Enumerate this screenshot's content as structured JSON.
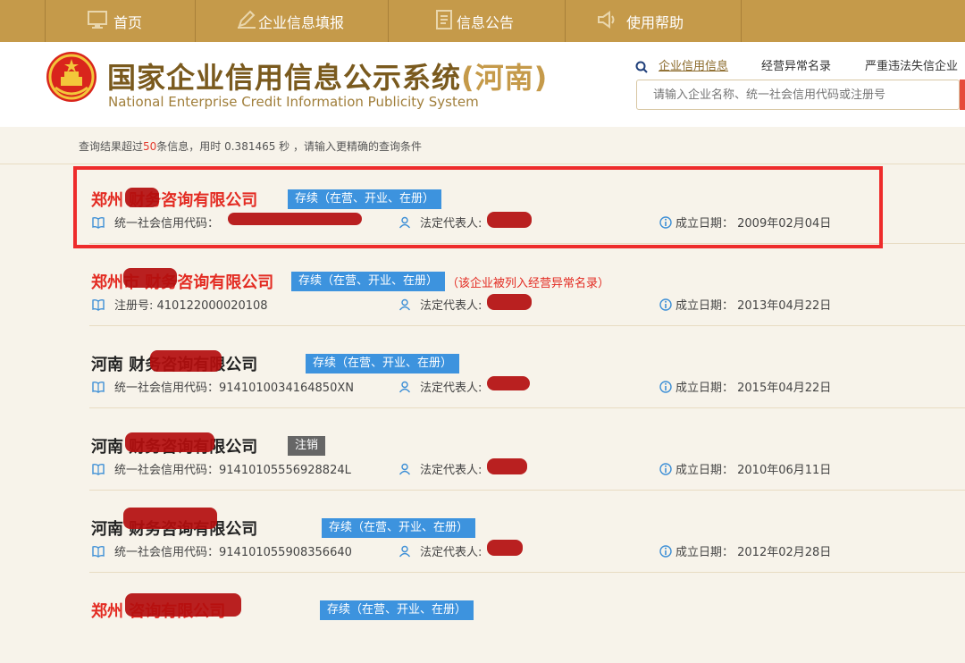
{
  "nav": [
    {
      "label": "首页",
      "icon": "monitor-icon"
    },
    {
      "label": "企业信息填报",
      "icon": "edit-icon"
    },
    {
      "label": "信息公告",
      "icon": "document-icon"
    },
    {
      "label": "使用帮助",
      "icon": "speaker-icon"
    }
  ],
  "header": {
    "title_main": "国家企业信用信息公示系统",
    "title_province": "(河南)",
    "title_en": "National Enterprise Credit Information Publicity System",
    "links": [
      "企业信用信息",
      "经营异常名录",
      "严重违法失信企业"
    ],
    "search_placeholder": "请输入企业名称、统一社会信用代码或注册号"
  },
  "summary": {
    "prefix": "查询结果超过",
    "count": "50",
    "suffix": "条信息，用时 0.381465 秒 ，请输入更精确的查询条件"
  },
  "labels": {
    "credit_code": "统一社会信用代码：",
    "reg_no": "注册号: ",
    "legal_rep": "法定代表人:",
    "founded": "成立日期：  "
  },
  "colors": {
    "nav": "#c59a4a",
    "accent_red": "#e32b22",
    "badge_blue": "#3d93de",
    "badge_gray": "#666666"
  },
  "results": [
    {
      "name": "郑州  财务咨询有限公司",
      "status": "存续（在营、开业、在册）",
      "status_type": "blue",
      "warn": "",
      "id_label": "credit_code",
      "id_value": "",
      "date": "2009年02月04日",
      "name_color": "red"
    },
    {
      "name": "郑州市  财务咨询有限公司",
      "status": "存续（在营、开业、在册）",
      "status_type": "blue",
      "warn": "（该企业被列入经营异常名录）",
      "id_label": "reg_no",
      "id_value": "410122000020108",
      "date": "2013年04月22日",
      "name_color": "red"
    },
    {
      "name": "河南  财务咨询有限公司",
      "status": "存续（在营、开业、在册）",
      "status_type": "blue",
      "warn": "",
      "id_label": "credit_code",
      "id_value": "9141010034164850XN",
      "date": "2015年04月22日",
      "name_color": "dark"
    },
    {
      "name": "河南  财务咨询有限公司",
      "status": "注销",
      "status_type": "gray",
      "warn": "",
      "id_label": "credit_code",
      "id_value": "91410105556928824L",
      "date": "2010年06月11日",
      "name_color": "dark"
    },
    {
      "name": "河南  财务咨询有限公司",
      "status": "存续（在营、开业、在册）",
      "status_type": "blue",
      "warn": "",
      "id_label": "credit_code",
      "id_value": "914101055908356640",
      "date": "2012年02月28日",
      "name_color": "dark"
    },
    {
      "name": "郑州  咨询有限公司",
      "status": "存续（在营、开业、在册）",
      "status_type": "blue",
      "warn": "",
      "id_label": "",
      "id_value": "",
      "date": "",
      "name_color": "red"
    }
  ]
}
